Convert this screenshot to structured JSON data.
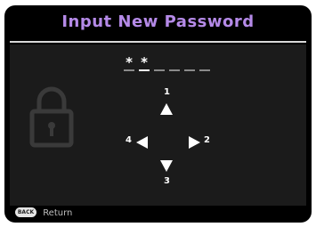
{
  "window": {
    "title": "Input New Password"
  },
  "password": {
    "slots": [
      "*",
      "*",
      "",
      "",
      "",
      ""
    ],
    "active_index": 1
  },
  "keypad": {
    "up_label": "1",
    "right_label": "2",
    "down_label": "3",
    "left_label": "4"
  },
  "footer": {
    "back_badge": "BACK",
    "return_label": "Return"
  },
  "icons": {
    "lock": "lock-icon",
    "arrows": [
      "arrow-up-icon",
      "arrow-right-icon",
      "arrow-down-icon",
      "arrow-left-icon"
    ]
  },
  "colors": {
    "title": "#b58ae8",
    "background": "#000000",
    "panel": "#1b1b1b"
  }
}
